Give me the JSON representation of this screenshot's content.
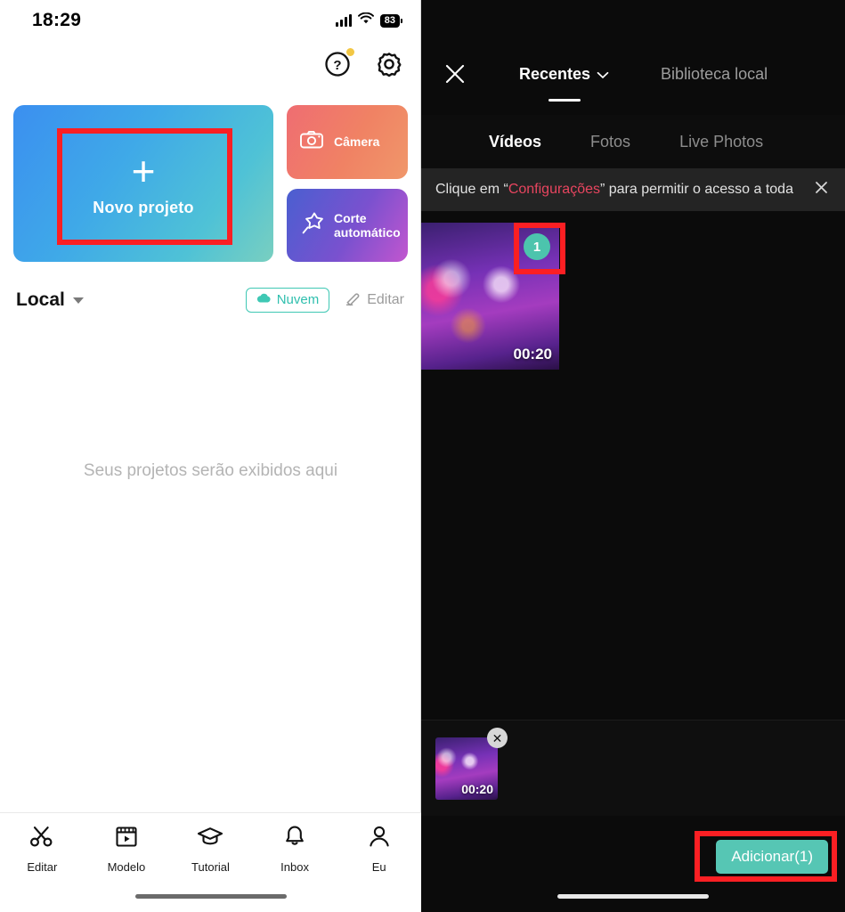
{
  "left": {
    "status_bar": {
      "time": "18:29",
      "battery": "83",
      "signal_icon": "cellular-signal-icon",
      "wifi_icon": "wifi-icon"
    },
    "top_actions": [
      {
        "name": "help-icon",
        "label": "?"
      },
      {
        "name": "gear-icon",
        "label": ""
      }
    ],
    "new_project": {
      "plus": "+",
      "label": "Novo projeto"
    },
    "mini_cards": [
      {
        "label": "Câmera",
        "icon": "camera-icon"
      },
      {
        "label": "Corte\nautomático",
        "line1": "Corte",
        "line2": "automático",
        "icon": "magic-wand-icon"
      }
    ],
    "local_row": {
      "title": "Local",
      "cloud_label": "Nuvem",
      "edit_label": "Editar"
    },
    "empty_state": "Seus projetos serão exibidos aqui",
    "bottom_nav": [
      {
        "label": "Editar",
        "icon": "scissors-icon"
      },
      {
        "label": "Modelo",
        "icon": "clapperboard-icon"
      },
      {
        "label": "Tutorial",
        "icon": "graduation-cap-icon"
      },
      {
        "label": "Inbox",
        "icon": "bell-icon"
      },
      {
        "label": "Eu",
        "icon": "person-icon"
      }
    ]
  },
  "right": {
    "header": {
      "close_icon": "close-icon",
      "source_tabs": [
        {
          "label": "Recentes",
          "active": true,
          "chevron": "chevron-down-icon"
        },
        {
          "label": "Biblioteca local",
          "active": false
        }
      ]
    },
    "media_tabs": [
      {
        "label": "Vídeos",
        "active": true
      },
      {
        "label": "Fotos",
        "active": false
      },
      {
        "label": "Live Photos",
        "active": false
      }
    ],
    "permission_banner": {
      "prefix": "Clique em “",
      "link": "Configurações",
      "suffix": "” para permitir o acesso a toda",
      "close_icon": "close-icon"
    },
    "media_items": [
      {
        "duration": "00:20",
        "selection_index": "1",
        "selected": true
      }
    ],
    "tray_items": [
      {
        "duration": "00:20",
        "remove_icon": "close-icon"
      }
    ],
    "footer": {
      "add_label": "Adicionar(1)"
    }
  },
  "annotations": {
    "highlight_color": "#fb1f23",
    "boxes": [
      "new-project-card",
      "selection-badge",
      "adicionar-button"
    ]
  },
  "colors": {
    "teal_accent": "#4cc4ad",
    "add_button": "#56c6b4",
    "banner_link": "#e8455f",
    "badge_dot": "#f2c744",
    "dark_bg": "#0b0b0b"
  }
}
